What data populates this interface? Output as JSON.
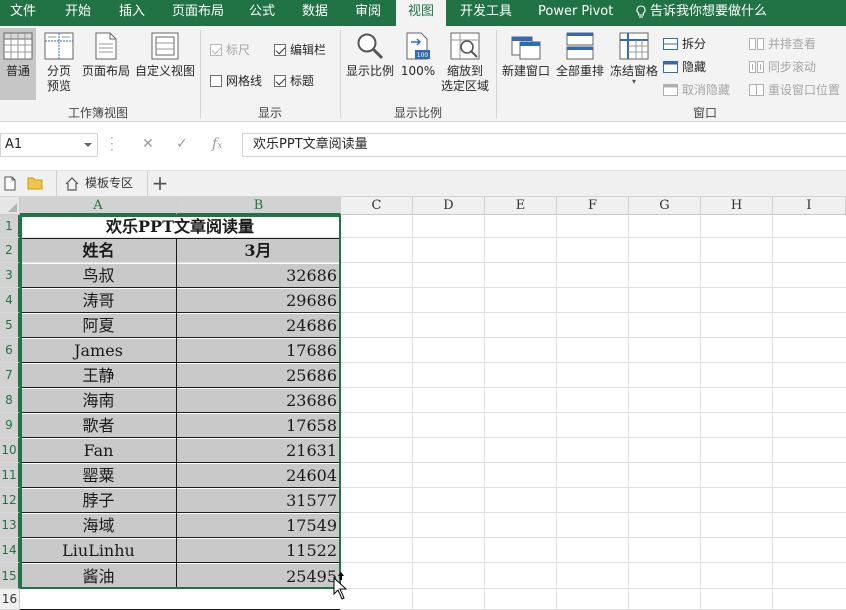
{
  "menu": {
    "tabs": [
      {
        "label": "文件",
        "active": false
      },
      {
        "label": "开始",
        "active": false
      },
      {
        "label": "插入",
        "active": false
      },
      {
        "label": "页面布局",
        "active": false
      },
      {
        "label": "公式",
        "active": false
      },
      {
        "label": "数据",
        "active": false
      },
      {
        "label": "审阅",
        "active": false
      },
      {
        "label": "视图",
        "active": true
      },
      {
        "label": "开发工具",
        "active": false
      },
      {
        "label": "Power Pivot",
        "active": false
      }
    ],
    "tell_me": "告诉我你想要做什么"
  },
  "ribbon": {
    "workbook_views": {
      "group_label": "工作簿视图",
      "normal": "普通",
      "page_break_line1": "分页",
      "page_break_line2": "预览",
      "page_layout": "页面布局",
      "custom_views": "自定义视图"
    },
    "show": {
      "group_label": "显示",
      "ruler": "标尺",
      "formula_bar": "编辑栏",
      "gridlines": "网格线",
      "headings": "标题"
    },
    "zoom": {
      "group_label": "显示比例",
      "zoom": "显示比例",
      "zoom_100": "100%",
      "zoom_sel_line1": "缩放到",
      "zoom_sel_line2": "选定区域"
    },
    "window": {
      "group_label": "窗口",
      "new_window": "新建窗口",
      "arrange_all": "全部重排",
      "freeze_panes": "冻结窗格",
      "split": "拆分",
      "hide": "隐藏",
      "unhide": "取消隐藏",
      "side_by_side": "并排查看",
      "sync_scroll": "同步滚动",
      "reset_position": "重设窗口位置"
    }
  },
  "formula_bar": {
    "name_box": "A1",
    "content": "欢乐PPT文章阅读量"
  },
  "file_tabs": {
    "template_tab": "模板专区"
  },
  "sheet": {
    "columns": [
      "A",
      "B",
      "C",
      "D",
      "E",
      "F",
      "G",
      "H",
      "I"
    ],
    "rows": [
      "1",
      "2",
      "3",
      "4",
      "5",
      "6",
      "7",
      "8",
      "9",
      "10",
      "11",
      "12",
      "13",
      "14",
      "15",
      "16"
    ],
    "title": "欢乐PPT文章阅读量",
    "header_name": "姓名",
    "header_month": "3月",
    "records": [
      {
        "name": "鸟叔",
        "value": "32686"
      },
      {
        "name": "涛哥",
        "value": "29686"
      },
      {
        "name": "阿夏",
        "value": "24686"
      },
      {
        "name": "James",
        "value": "17686"
      },
      {
        "name": "王静",
        "value": "25686"
      },
      {
        "name": "海南",
        "value": "23686"
      },
      {
        "name": "歌者",
        "value": "17658"
      },
      {
        "name": "Fan",
        "value": "21631"
      },
      {
        "name": "罂粟",
        "value": "24604"
      },
      {
        "name": "脖子",
        "value": "31577"
      },
      {
        "name": "海域",
        "value": "17549"
      },
      {
        "name": "LiuLinhu",
        "value": "11522"
      },
      {
        "name": "酱油",
        "value": "25495"
      }
    ]
  },
  "theme": {
    "accent": "#217346",
    "cell_fill": "#c9c9c9"
  }
}
